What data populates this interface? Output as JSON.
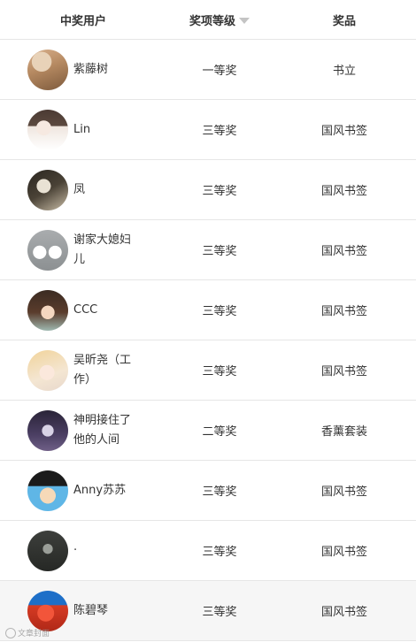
{
  "header": {
    "user_col": "中奖用户",
    "level_col": "奖项等级",
    "prize_col": "奖品"
  },
  "rows": [
    {
      "name": "紫藤树",
      "level": "一等奖",
      "prize": "书立",
      "avatar": "avatar-photo-icon"
    },
    {
      "name": "Lin",
      "level": "三等奖",
      "prize": "国风书签",
      "avatar": "avatar-photo-icon"
    },
    {
      "name": "凤",
      "level": "三等奖",
      "prize": "国风书签",
      "avatar": "avatar-photo-icon"
    },
    {
      "name": "谢家大媳妇儿",
      "level": "三等奖",
      "prize": "国风书签",
      "avatar": "avatar-photo-icon"
    },
    {
      "name": "CCC",
      "level": "三等奖",
      "prize": "国风书签",
      "avatar": "avatar-photo-icon"
    },
    {
      "name": "吴昕尧（工作）",
      "level": "三等奖",
      "prize": "国风书签",
      "avatar": "avatar-photo-icon"
    },
    {
      "name": "神明接住了他的人间",
      "level": "二等奖",
      "prize": "香薰套装",
      "avatar": "avatar-photo-icon"
    },
    {
      "name": "Anny苏苏",
      "level": "三等奖",
      "prize": "国风书签",
      "avatar": "avatar-photo-icon"
    },
    {
      "name": "·",
      "level": "三等奖",
      "prize": "国风书签",
      "avatar": "avatar-photo-icon"
    },
    {
      "name": "陈碧琴",
      "level": "三等奖",
      "prize": "国风书签",
      "avatar": "avatar-photo-icon"
    }
  ],
  "watermark": "文章封面"
}
